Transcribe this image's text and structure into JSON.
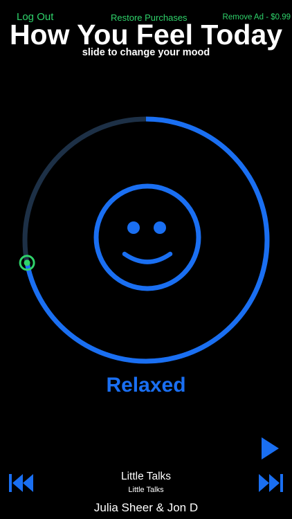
{
  "top_bar": {
    "logout_label": "Log Out",
    "restore_label": "Restore Purchases",
    "remove_ad_label": "Remove Ad - $0.99"
  },
  "header": {
    "title": "How You Feel Today",
    "subtitle": "slide to change your mood"
  },
  "mood": {
    "label": "Relaxed",
    "face_icon": "smiley-face-icon",
    "slider_fraction": 0.72,
    "accent_color": "#1a6ff2",
    "track_color": "#1d3046",
    "handle_color": "#2fd36b"
  },
  "player": {
    "song_title": "Little Talks",
    "album": "Little Talks",
    "artist": "Julia Sheer & Jon D",
    "controls": {
      "play_icon": "play-icon",
      "prev_icon": "skip-back-icon",
      "next_icon": "skip-forward-icon"
    }
  },
  "colors": {
    "background": "#000000",
    "link_green": "#2fd36b",
    "text_white": "#ffffff"
  }
}
